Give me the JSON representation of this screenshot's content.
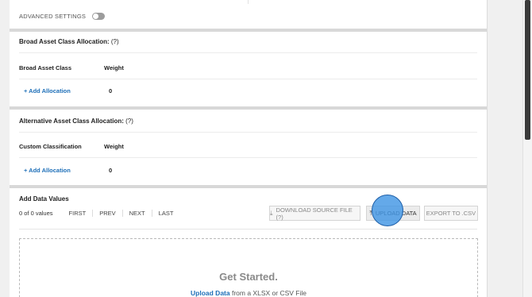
{
  "advanced_settings": {
    "label": "ADVANCED SETTINGS",
    "enabled": false
  },
  "broad_allocation": {
    "title": "Broad Asset Class Allocation:",
    "help": "(?)",
    "col_class": "Broad Asset Class",
    "col_weight": "Weight",
    "add_label": "+ Add Allocation",
    "total": "0"
  },
  "alt_allocation": {
    "title": "Alternative Asset Class Allocation:",
    "help": "(?)",
    "col_class": "Custom Classification",
    "col_weight": "Weight",
    "add_label": "+ Add Allocation",
    "total": "0"
  },
  "data_values": {
    "title": "Add Data Values",
    "count": "0 of 0 values",
    "pager": [
      "FIRST",
      "PREV",
      "NEXT",
      "LAST"
    ],
    "download_label": "DOWNLOAD SOURCE FILE (?)",
    "upload_label": "UPLOAD DATA",
    "export_label": "EXPORT TO .CSV",
    "download_icon": "download-icon",
    "upload_icon": "upload-icon"
  },
  "dropzone": {
    "title": "Get Started.",
    "link": "Upload Data",
    "rest": " from a XLSX or CSV File"
  },
  "colors": {
    "link": "#1e6fb8",
    "cursor": "#4296e4",
    "separator": "#d8d8d8"
  }
}
